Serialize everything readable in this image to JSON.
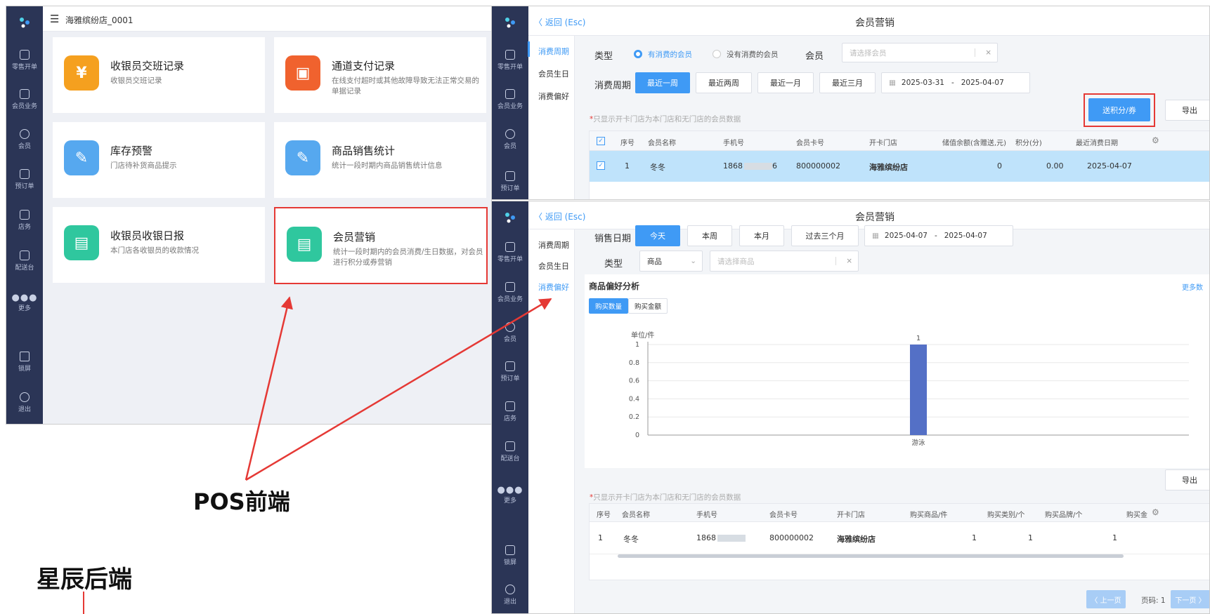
{
  "pos": {
    "store_title": "海雅缤纷店_0001",
    "sidebar": [
      "零售开单",
      "会员业务",
      "会员",
      "预订单",
      "店务",
      "配送台",
      "更多",
      "锁屏",
      "退出"
    ],
    "cards": [
      {
        "title": "收银员交班记录",
        "desc": "收银员交班记录",
        "color": "#f5a01f",
        "glyph": "¥"
      },
      {
        "title": "通道支付记录",
        "desc": "在线支付超时或其他故障导致无法正常交易的单据记录",
        "color": "#f0622e",
        "glyph": "▣"
      },
      {
        "title": "库存预警",
        "desc": "门店待补货商品提示",
        "color": "#56a8ef",
        "glyph": "✎"
      },
      {
        "title": "商品销售统计",
        "desc": "统计一段时期内商品销售统计信息",
        "color": "#56a8ef",
        "glyph": "✎"
      },
      {
        "title": "收银员收银日报",
        "desc": "本门店各收银员的收款情况",
        "color": "#2fc79e",
        "glyph": "▤"
      },
      {
        "title": "会员营销",
        "desc": "统计一段时期内的会员消费/生日数据，对会员进行积分或券营销",
        "color": "#2fc79e",
        "glyph": "▤"
      }
    ]
  },
  "annotations": {
    "pos_label": "POS前端",
    "backend_label": "星辰后端"
  },
  "mkt_top": {
    "back": "〈 返回 (Esc)",
    "title": "会员营销",
    "subnav": [
      "消费周期",
      "会员生日",
      "消费偏好"
    ],
    "type_label": "类型",
    "radio1": "有消费的会员",
    "radio2": "没有消费的会员",
    "member_label": "会员",
    "member_placeholder": "请选择会员",
    "period_label": "消费周期",
    "periods": [
      "最近一周",
      "最近两周",
      "最近一月",
      "最近三月"
    ],
    "date_from": "2025-03-31",
    "date_to": "2025-04-07",
    "send_btn": "送积分/券",
    "export_btn": "导出",
    "note": "只显示开卡门店为本门店和无门店的会员数据",
    "headers": [
      "序号",
      "会员名称",
      "手机号",
      "会员卡号",
      "开卡门店",
      "储值余额(含赠送,元)",
      "积分(分)",
      "最近消费日期"
    ],
    "row": [
      "1",
      "冬冬",
      "1868",
      "800000002",
      "海雅缤纷店",
      "0",
      "0.00",
      "2025-04-07"
    ]
  },
  "mkt_bottom": {
    "back": "〈 返回 (Esc)",
    "title": "会员营销",
    "subnav": [
      "消费周期",
      "会员生日",
      "消费偏好"
    ],
    "date_label": "销售日期",
    "periods": [
      "今天",
      "本周",
      "本月",
      "过去三个月"
    ],
    "date_from": "2025-04-07",
    "date_to": "2025-04-07",
    "type_label": "类型",
    "type_value": "商品",
    "product_placeholder": "请选择商品",
    "analysis_title": "商品偏好分析",
    "more": "更多数",
    "tabs": [
      "购买数量",
      "购买金额"
    ],
    "export_btn": "导出",
    "note": "只显示开卡门店为本门店和无门店的会员数据",
    "headers": [
      "序号",
      "会员名称",
      "手机号",
      "会员卡号",
      "开卡门店",
      "购买商品/件",
      "购买类别/个",
      "购买品牌/个",
      "购买金"
    ],
    "row": [
      "1",
      "冬冬",
      "1868",
      "800000002",
      "海雅缤纷店",
      "1",
      "1",
      "1"
    ],
    "pager": {
      "prev": "〈 上一页",
      "page": "页码: 1",
      "next": "下一页 〉"
    }
  },
  "chart_data": {
    "type": "bar",
    "ylabel": "单位/件",
    "categories": [
      "游泳"
    ],
    "values": [
      1
    ],
    "ylim": [
      0,
      1
    ],
    "yticks": [
      "1",
      "0.8",
      "0.6",
      "0.4",
      "0.2",
      "0"
    ],
    "bar_color": "#5470c6"
  }
}
